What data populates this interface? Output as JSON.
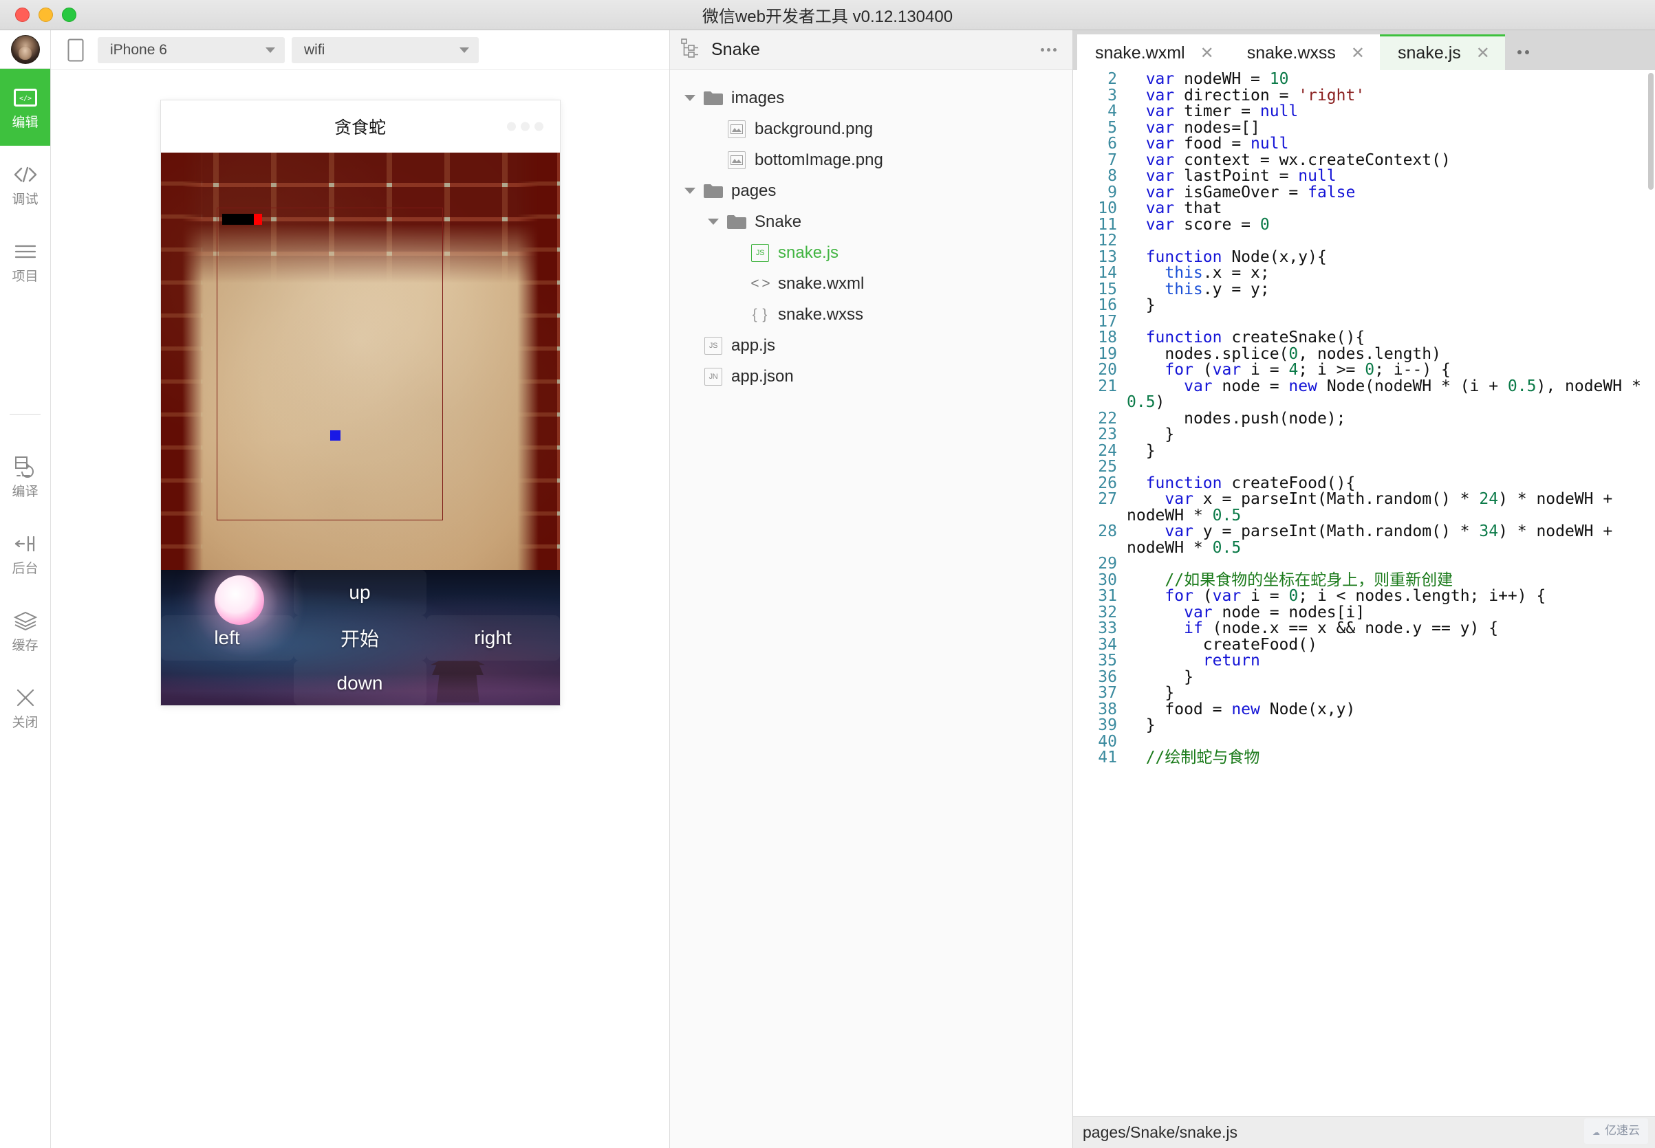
{
  "window": {
    "title": "微信web开发者工具 v0.12.130400",
    "traffic_lights": [
      "close",
      "minimize",
      "maximize"
    ]
  },
  "rail": {
    "items": [
      {
        "label": "编辑",
        "icon": "code-window-icon",
        "active": true
      },
      {
        "label": "调试",
        "icon": "angle-brackets-icon",
        "active": false
      },
      {
        "label": "项目",
        "icon": "hamburger-lines-icon",
        "active": false
      },
      {
        "label": "编译",
        "icon": "refresh-document-icon",
        "active": false
      },
      {
        "label": "后台",
        "icon": "background-switch-icon",
        "active": false
      },
      {
        "label": "缓存",
        "icon": "layers-icon",
        "active": false
      },
      {
        "label": "关闭",
        "icon": "close-x-icon",
        "active": false
      }
    ]
  },
  "simulator": {
    "device": "iPhone 6",
    "network": "wifi",
    "phone_icon": "phone-outline-icon",
    "page_title": "贪食蛇",
    "controls": {
      "up": "up",
      "left": "left",
      "start": "开始",
      "right": "right",
      "down": "down"
    }
  },
  "project": {
    "name": "Snake",
    "icon": "project-tree-icon",
    "more_icon": "more-dots-icon",
    "tree": [
      {
        "depth": 0,
        "label": "images",
        "kind": "folder",
        "expanded": true,
        "selected": false
      },
      {
        "depth": 1,
        "label": "background.png",
        "kind": "image",
        "expanded": null,
        "selected": false
      },
      {
        "depth": 1,
        "label": "bottomImage.png",
        "kind": "image",
        "expanded": null,
        "selected": false
      },
      {
        "depth": 0,
        "label": "pages",
        "kind": "folder",
        "expanded": true,
        "selected": false
      },
      {
        "depth": 1,
        "label": "Snake",
        "kind": "folder",
        "expanded": true,
        "selected": false
      },
      {
        "depth": 2,
        "label": "snake.js",
        "kind": "js",
        "expanded": null,
        "selected": true
      },
      {
        "depth": 2,
        "label": "snake.wxml",
        "kind": "wxml",
        "expanded": null,
        "selected": false
      },
      {
        "depth": 2,
        "label": "snake.wxss",
        "kind": "wxss",
        "expanded": null,
        "selected": false
      },
      {
        "depth": 0,
        "label": "app.js",
        "kind": "js2",
        "expanded": null,
        "selected": false
      },
      {
        "depth": 0,
        "label": "app.json",
        "kind": "json",
        "expanded": null,
        "selected": false
      }
    ]
  },
  "editor": {
    "tabs": [
      {
        "label": "snake.wxml",
        "active": false,
        "close_icon": "close-icon"
      },
      {
        "label": "snake.wxss",
        "active": false,
        "close_icon": "close-icon"
      },
      {
        "label": "snake.js",
        "active": true,
        "close_icon": "close-icon"
      }
    ],
    "overflow_icon": "more-dots-icon",
    "status_path": "pages/Snake/snake.js",
    "accent_color": "#3ec13e",
    "active_tab_bg": "#eef7ee",
    "lines": [
      {
        "n": "2",
        "t": "  var nodeWH = 10"
      },
      {
        "n": "3",
        "t": "  var direction = 'right'"
      },
      {
        "n": "4",
        "t": "  var timer = null"
      },
      {
        "n": "5",
        "t": "  var nodes=[]"
      },
      {
        "n": "6",
        "t": "  var food = null"
      },
      {
        "n": "7",
        "t": "  var context = wx.createContext()"
      },
      {
        "n": "8",
        "t": "  var lastPoint = null"
      },
      {
        "n": "9",
        "t": "  var isGameOver = false"
      },
      {
        "n": "10",
        "t": "  var that"
      },
      {
        "n": "11",
        "t": "  var score = 0"
      },
      {
        "n": "12",
        "t": ""
      },
      {
        "n": "13",
        "t": "  function Node(x,y){"
      },
      {
        "n": "14",
        "t": "    this.x = x;"
      },
      {
        "n": "15",
        "t": "    this.y = y;"
      },
      {
        "n": "16",
        "t": "  }"
      },
      {
        "n": "17",
        "t": ""
      },
      {
        "n": "18",
        "t": "  function createSnake(){"
      },
      {
        "n": "19",
        "t": "    nodes.splice(0, nodes.length)"
      },
      {
        "n": "20",
        "t": "    for (var i = 4; i >= 0; i--) {"
      },
      {
        "n": "21",
        "t": "      var node = new Node(nodeWH * (i + 0.5), nodeWH * 0.5)"
      },
      {
        "n": "22",
        "t": "      nodes.push(node);"
      },
      {
        "n": "23",
        "t": "    }"
      },
      {
        "n": "24",
        "t": "  }"
      },
      {
        "n": "25",
        "t": ""
      },
      {
        "n": "26",
        "t": "  function createFood(){"
      },
      {
        "n": "27",
        "t": "    var x = parseInt(Math.random() * 24) * nodeWH + nodeWH * 0.5"
      },
      {
        "n": "28",
        "t": "    var y = parseInt(Math.random() * 34) * nodeWH + nodeWH * 0.5"
      },
      {
        "n": "29",
        "t": ""
      },
      {
        "n": "30",
        "t": "    //如果食物的坐标在蛇身上，则重新创建"
      },
      {
        "n": "31",
        "t": "    for (var i = 0; i < nodes.length; i++) {"
      },
      {
        "n": "32",
        "t": "      var node = nodes[i]"
      },
      {
        "n": "33",
        "t": "      if (node.x == x && node.y == y) {"
      },
      {
        "n": "34",
        "t": "        createFood()"
      },
      {
        "n": "35",
        "t": "        return"
      },
      {
        "n": "36",
        "t": "      }"
      },
      {
        "n": "37",
        "t": "    }"
      },
      {
        "n": "38",
        "t": "    food = new Node(x,y)"
      },
      {
        "n": "39",
        "t": "  }"
      },
      {
        "n": "40",
        "t": ""
      },
      {
        "n": "41",
        "t": "  //绘制蛇与食物"
      }
    ]
  },
  "watermark": {
    "text": "亿速云",
    "icon": "cloud-icon"
  }
}
